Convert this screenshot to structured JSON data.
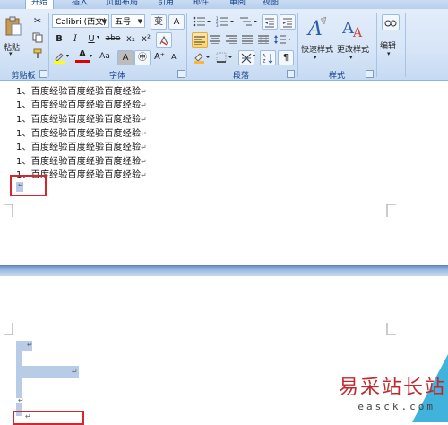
{
  "tabs": [
    "开始",
    "插入",
    "页面布局",
    "引用",
    "邮件",
    "审阅",
    "视图"
  ],
  "clipboard": {
    "paste_label": "粘贴",
    "group_label": "剪贴板"
  },
  "font": {
    "family": "Calibri (西文)",
    "size": "五号",
    "phonetic": "变",
    "border_char": "A",
    "bold": "B",
    "italic": "I",
    "underline": "U",
    "strike": "abe",
    "subscript": "x₂",
    "superscript": "x²",
    "font_color": "A",
    "change_case": "Aa",
    "char_shade": "A",
    "enclose": "㊥",
    "grow": "A⁺",
    "shrink": "A⁻",
    "group_label": "字体"
  },
  "paragraph": {
    "group_label": "段落"
  },
  "styles": {
    "quick_label": "快速样式",
    "change_label": "更改样式",
    "group_label": "样式"
  },
  "editing": {
    "label": "编辑"
  },
  "colors": {
    "accent": "#15428b",
    "highlight": "#b8cce8",
    "annotation": "#d0282e"
  },
  "document": {
    "lines": [
      "1、百度经验百度经验百度经验",
      "1、百度经验百度经验百度经验",
      "1、百度经验百度经验百度经验",
      "1、百度经验百度经验百度经验",
      "1、百度经验百度经验百度经验",
      "1、百度经验百度经验百度经验",
      "1、百度经验百度经验百度经验"
    ],
    "para_mark": "↵"
  },
  "watermark": {
    "text": "易采站长站",
    "url": "easck.com"
  }
}
